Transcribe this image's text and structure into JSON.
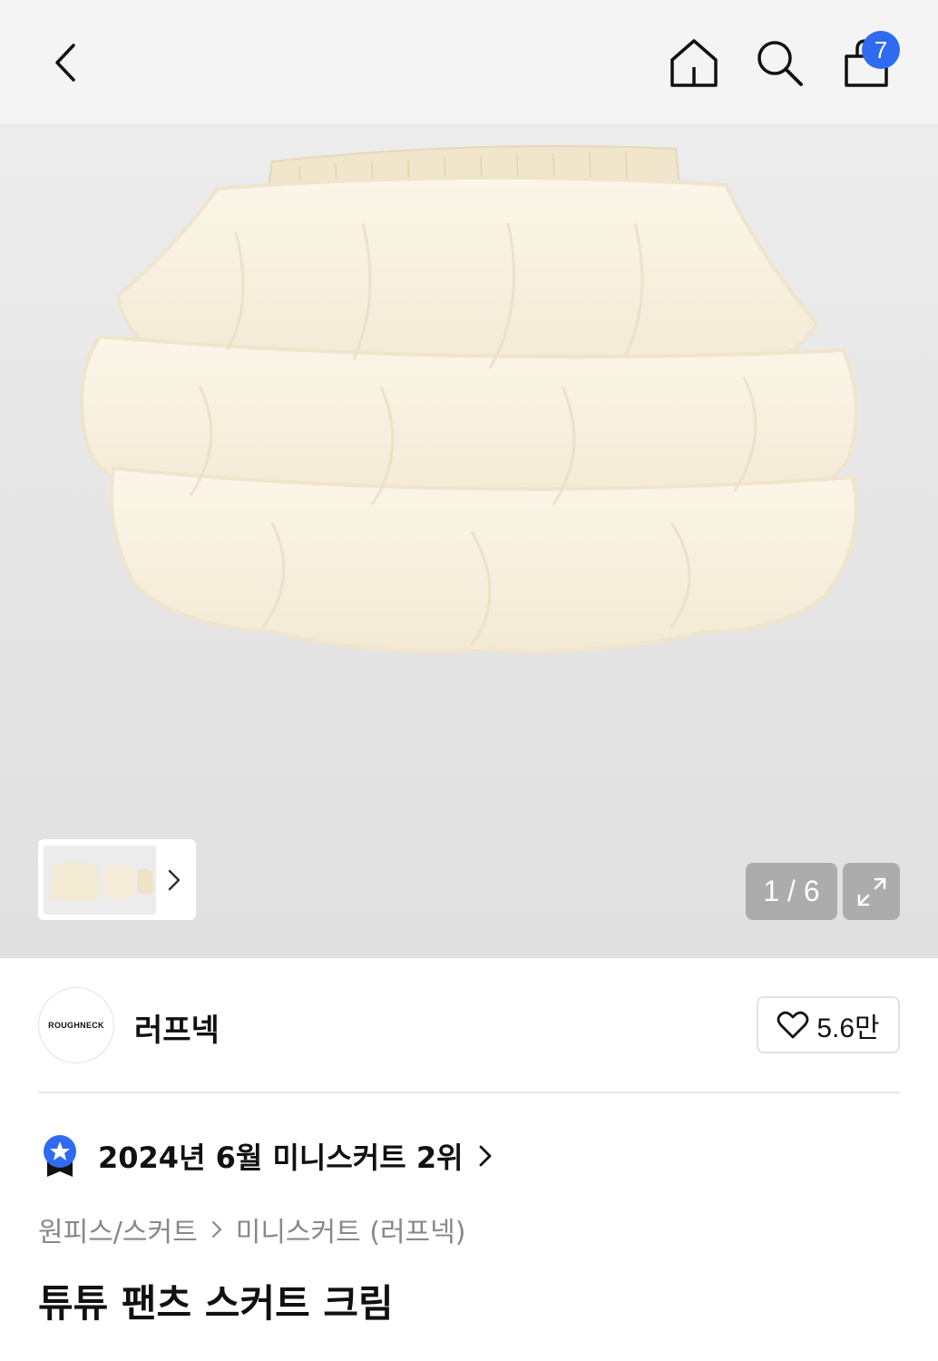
{
  "header": {
    "icons": [
      "back-arrow-icon",
      "home-icon",
      "search-icon",
      "shopping-bag-icon"
    ],
    "cart_count": "7"
  },
  "gallery": {
    "pager_text": "1 / 6",
    "expand_icon": "expand-icon",
    "thumb_chevron_icon": "chevron-right-icon"
  },
  "brand": {
    "logo_text": "ROUGHNECK",
    "name": "러프넥",
    "like_count": "5.6만",
    "like_icon": "heart-icon"
  },
  "ranking": {
    "text": "2024년 6월 미니스커트 2위",
    "icon": "ranking-badge-icon",
    "accent": "#2f6bf0"
  },
  "breadcrumb": {
    "items": [
      "원피스/스커트",
      "미니스커트 (러프넥)"
    ]
  },
  "product": {
    "title": "튜튜 팬츠 스커트 크림"
  }
}
